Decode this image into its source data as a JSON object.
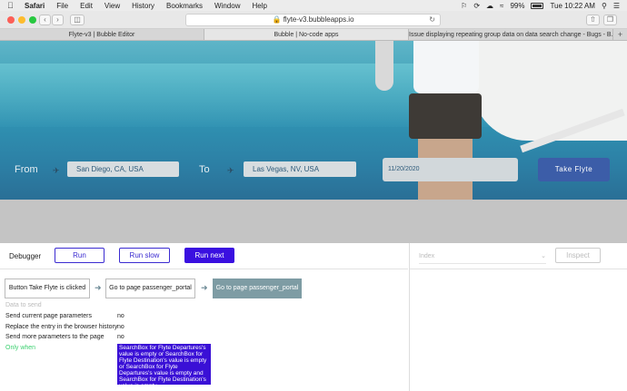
{
  "menubar": {
    "app": "Safari",
    "items": [
      "File",
      "Edit",
      "View",
      "History",
      "Bookmarks",
      "Window",
      "Help"
    ],
    "battery": "99%",
    "clock": "Tue 10:22 AM"
  },
  "browser": {
    "url": "flyte-v3.bubbleapps.io",
    "tabs": [
      {
        "label": "Flyte-v3 | Bubble Editor"
      },
      {
        "label": "Bubble | No-code apps"
      },
      {
        "label": "Issue displaying repeating group data on data search change - Bugs - B..."
      }
    ],
    "tab_add": "+"
  },
  "search": {
    "from_label": "From",
    "from_value": "San Diego, CA, USA",
    "to_label": "To",
    "to_value": "Las Vegas, NV, USA",
    "date_value": "11/20/2020",
    "submit_label": "Take Flyte"
  },
  "debugger": {
    "title": "Debugger",
    "run_label": "Run",
    "run_slow_label": "Run slow",
    "run_next_label": "Run next",
    "inspect_label": "Inspect",
    "select_placeholder": "Index",
    "steps": [
      {
        "label": "Button Take Flyte is clicked"
      },
      {
        "label": "Go to page passenger_portal"
      },
      {
        "label": "Go to page passenger_portal"
      }
    ],
    "faded_row": "Data to send",
    "properties": [
      {
        "label": "Send current page parameters",
        "value": "no"
      },
      {
        "label": "Replace the entry in the browser history",
        "value": "no"
      },
      {
        "label": "Send more parameters to the page",
        "value": "no"
      }
    ],
    "only_when_label": "Only when",
    "only_when_value": "SearchBox for Flyte Departures's value is empty or SearchBox for Flyte Destination's value is empty or SearchBox for Flyte Departures's value is empty and SearchBox for Flyte Destination's value is empty"
  }
}
